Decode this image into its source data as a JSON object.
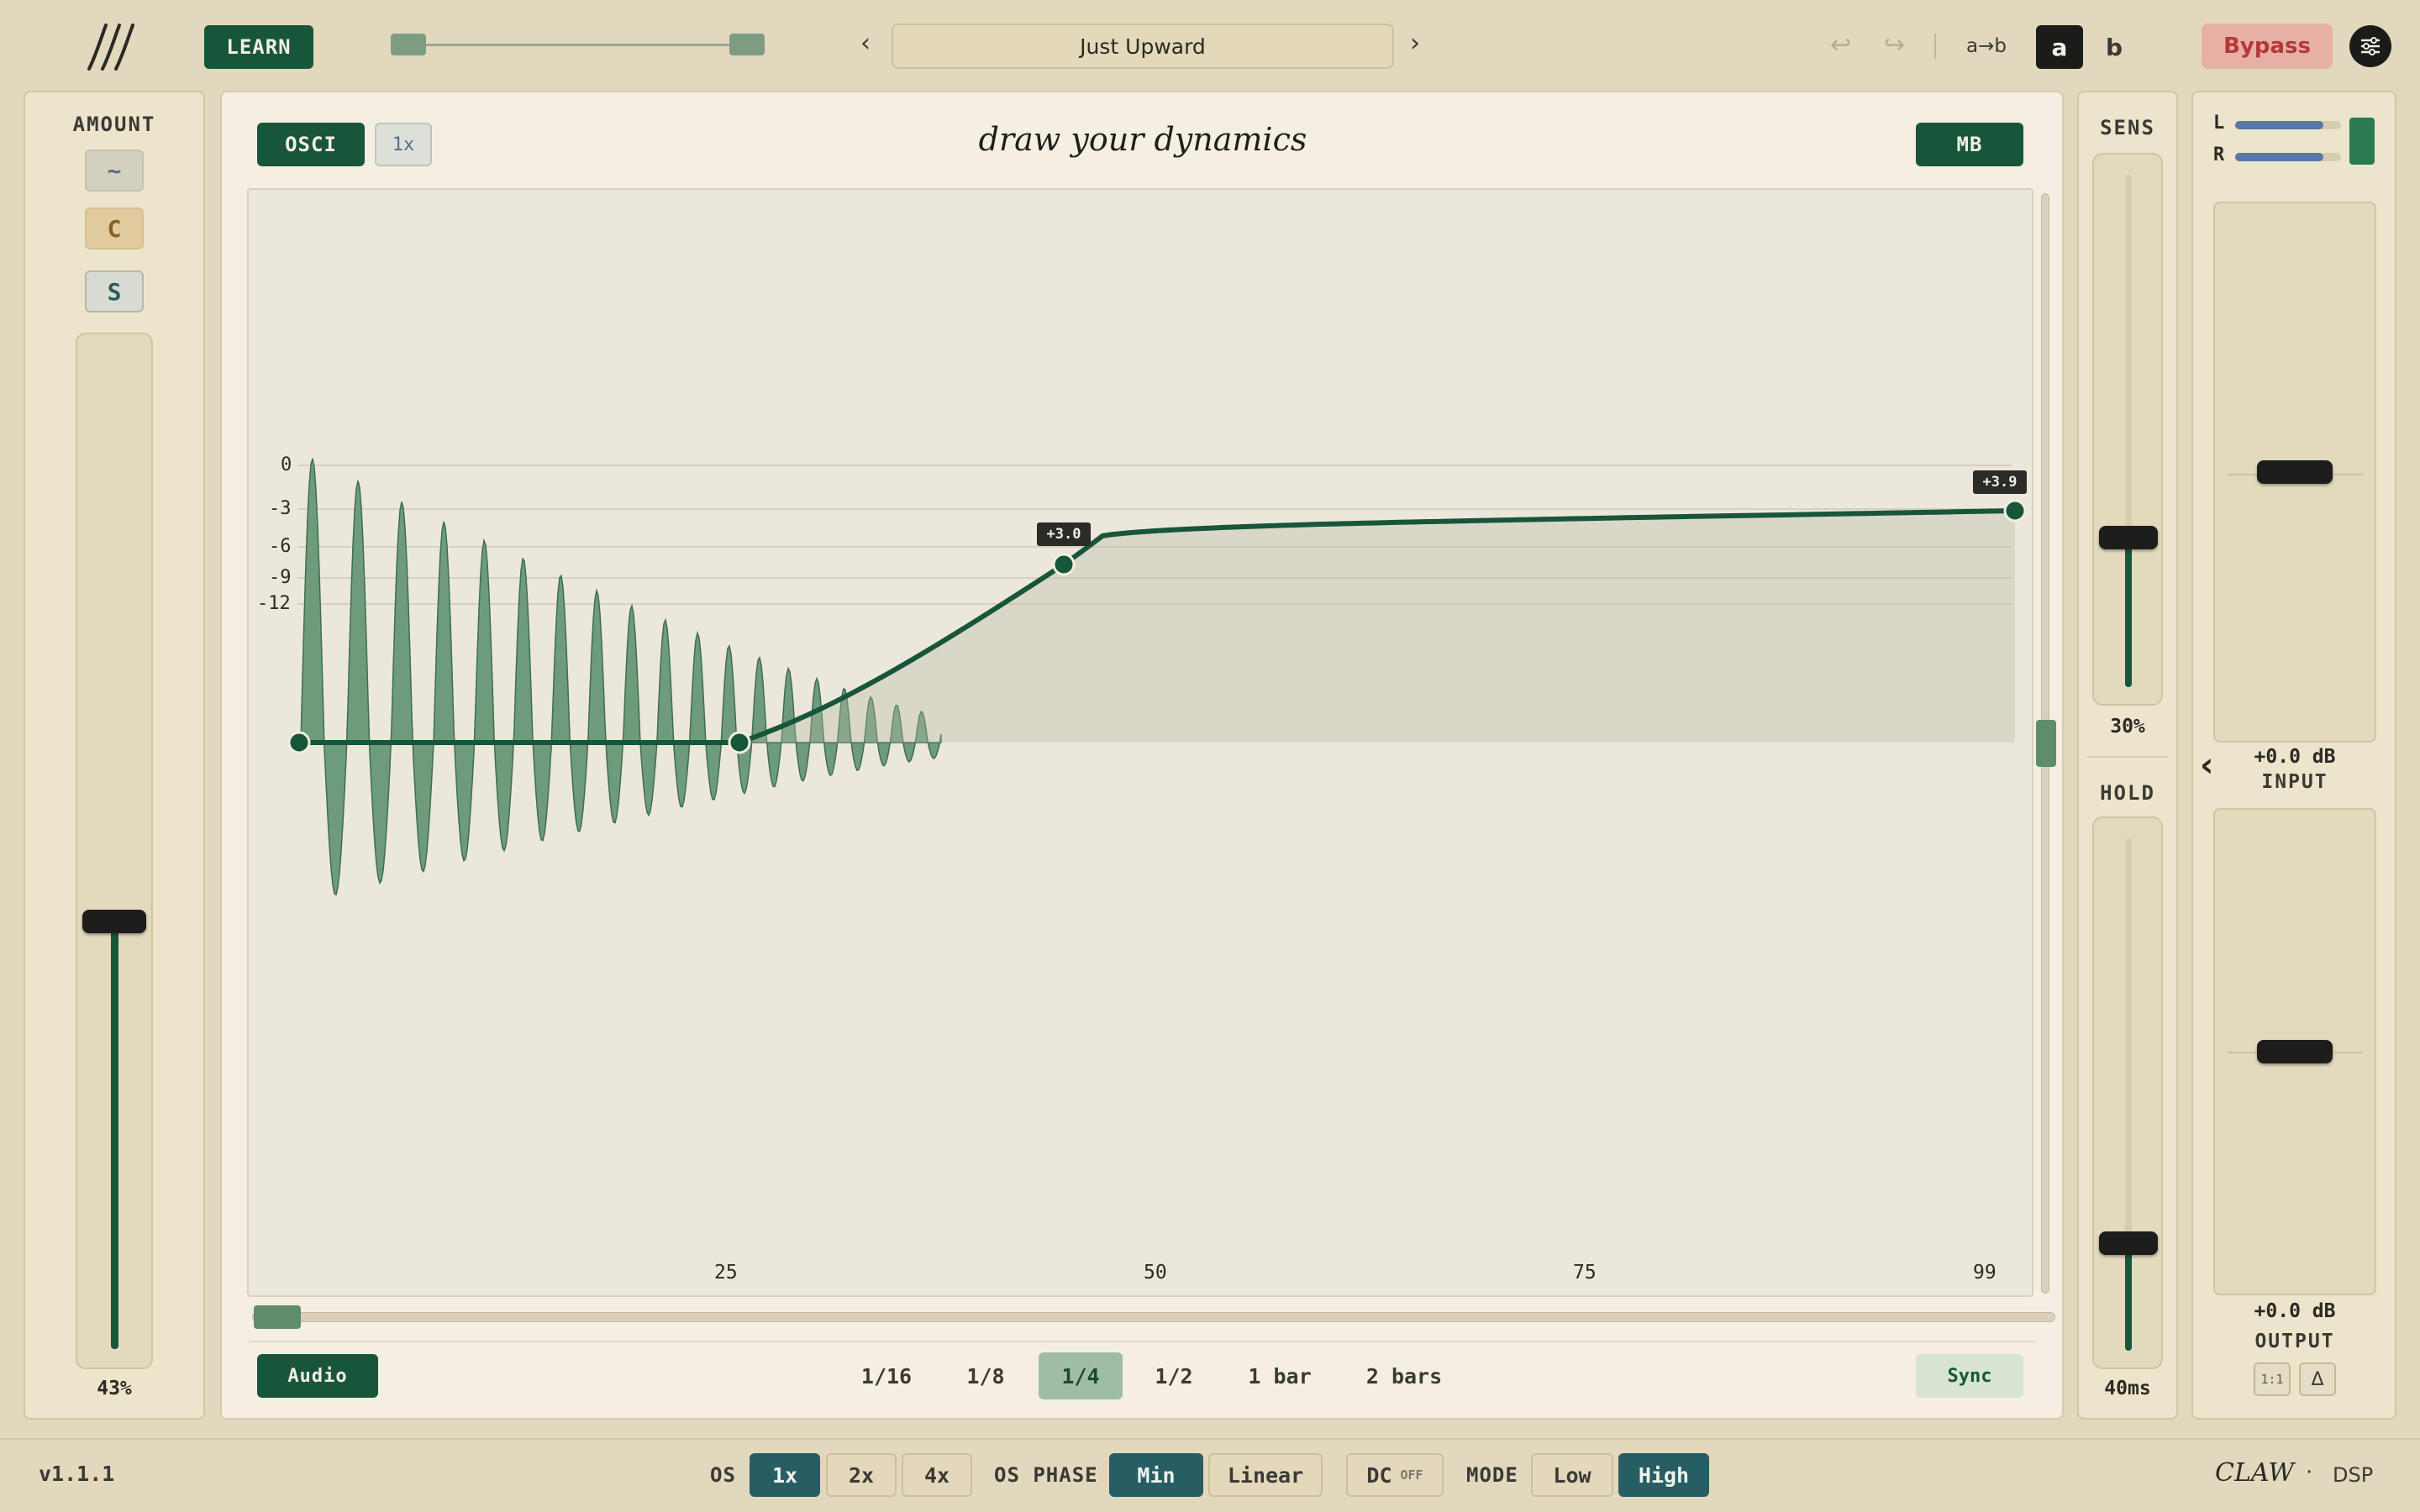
{
  "header": {
    "learn_label": "LEARN",
    "preset_name": "Just Upward",
    "prev_arrow": "‹",
    "next_arrow": "›",
    "undo_icon": "↩",
    "redo_icon": "↪",
    "ab_copy_label": "a→b",
    "a_label": "a",
    "b_label": "b",
    "bypass_label": "Bypass"
  },
  "amount": {
    "title": "AMOUNT",
    "toggles": [
      "~",
      "C",
      "S"
    ],
    "value_text": "43%",
    "value": 0.43
  },
  "main": {
    "osci_label": "OSCI",
    "zoom_label": "1x",
    "title": "draw your dynamics",
    "mb_label": "MB",
    "y_ticks": [
      "0",
      "-3",
      "-6",
      "-9",
      "-12"
    ],
    "x_ticks": [
      "25",
      "50",
      "75",
      "99"
    ],
    "point_labels": [
      "+3.0",
      "+3.9"
    ],
    "audio_label": "Audio",
    "divisions": [
      "1/16",
      "1/8",
      "1/4",
      "1/2",
      "1 bar",
      "2 bars"
    ],
    "active_division": "1/4",
    "sync_label": "Sync"
  },
  "sens": {
    "title": "SENS",
    "value_text": "30%",
    "value": 0.3
  },
  "hold": {
    "title": "HOLD",
    "value_text": "40ms"
  },
  "io": {
    "meter_l": "L",
    "meter_r": "R",
    "collapse_arrow": "‹",
    "input_value": "+0.0 dB",
    "input_label": "INPUT",
    "output_value": "+0.0 dB",
    "output_label": "OUTPUT",
    "ratio_label": "1:1",
    "delta_label": "Δ"
  },
  "footer": {
    "version": "v1.1.1",
    "os_label": "OS",
    "os_options": [
      "1x",
      "2x",
      "4x"
    ],
    "os_active": "1x",
    "os_phase_label": "OS PHASE",
    "phase_options": [
      "Min",
      "Linear"
    ],
    "phase_active": "Min",
    "dc_label": "DC",
    "dc_state": "OFF",
    "mode_label": "MODE",
    "mode_options": [
      "Low",
      "High"
    ],
    "mode_active": "High",
    "brand": "CLAW",
    "brand_dot": "·",
    "brand_suffix": "DSP"
  },
  "colors": {
    "accent_green": "#17563a",
    "teal_active": "#275e63",
    "bypass_red": "#b5383a",
    "background": "#e2d8bd"
  }
}
